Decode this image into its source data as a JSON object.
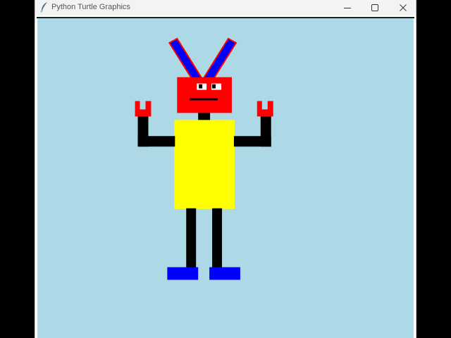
{
  "window": {
    "title": "Python Turtle Graphics",
    "icon": "feather-icon"
  },
  "controls": {
    "minimize_icon": "minimize-icon",
    "maximize_icon": "maximize-icon",
    "close_icon": "close-icon"
  },
  "canvas": {
    "background": "#add8e6"
  },
  "robot": {
    "colors": {
      "head": "#ff0000",
      "antennas": "#0000ff",
      "antenna_outline": "#ff0000",
      "eyes": "#ffffff",
      "pupils": "#000000",
      "mouth": "#000000",
      "neck": "#000000",
      "body": "#ffff00",
      "arms": "#000000",
      "hands": "#ff0000",
      "legs": "#000000",
      "feet": "#0000ff"
    }
  }
}
